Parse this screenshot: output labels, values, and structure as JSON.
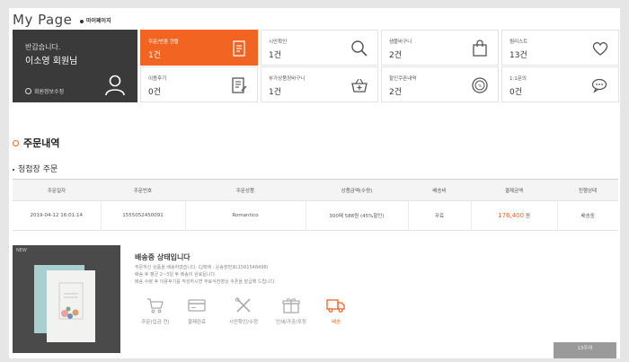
{
  "header": {
    "title": "My Page",
    "subtitle": "마이페이지"
  },
  "welcome": {
    "greeting": "반갑습니다.",
    "name": "이소영 회원님",
    "edit_label": "회원정보수정"
  },
  "tiles": [
    {
      "label": "주문/반품 현황",
      "count": "1건",
      "icon": "receipt-icon"
    },
    {
      "label": "시안확인",
      "count": "1건",
      "icon": "search-icon"
    },
    {
      "label": "샘플바구니",
      "count": "2건",
      "icon": "shopping-bag-icon"
    },
    {
      "label": "찜리스트",
      "count": "13건",
      "icon": "heart-icon"
    },
    {
      "label": "이용후기",
      "count": "0건",
      "icon": "review-icon"
    },
    {
      "label": "부가상품장바구니",
      "count": "1건",
      "icon": "basket-icon"
    },
    {
      "label": "할인쿠폰내역",
      "count": "2건",
      "icon": "coupon-icon"
    },
    {
      "label": "1:1문의",
      "count": "0건",
      "icon": "chat-icon"
    }
  ],
  "accent_color": "#f26422",
  "orders": {
    "section_title": "주문내역",
    "sub_title": "청첩장 주문",
    "columns": [
      "주문일자",
      "주문번호",
      "주문상품",
      "상품금액(수량)",
      "배송비",
      "결제금액",
      "진행상태"
    ],
    "rows": [
      {
        "date": "2019-04-12 16:01:14",
        "order_no": "1555052450091",
        "product": "Romantico",
        "amount": "300매 588원 (45%할인)",
        "shipping": "무료",
        "payment": "176,400",
        "currency": "원",
        "status": "배송중"
      }
    ]
  },
  "product_badge": "NEW",
  "shipping": {
    "title": "배송중 상태입니다",
    "lines": [
      "주문하신 상품을 배송하였습니다. CJ택배 : 운송장번호(1561548498)",
      "배송 후 평균 2~3일 후 배송이 완료됩니다.",
      "배송 수령 후 이용후기를 작성하시면 무료식전영상 쿠폰을 발급해 드립니다."
    ],
    "steps": [
      {
        "label": "주문(입금 전)",
        "icon": "cart-icon"
      },
      {
        "label": "결제완료",
        "icon": "card-icon"
      },
      {
        "label": "시안확인/수정",
        "icon": "tools-icon"
      },
      {
        "label": "인쇄/가공/포장",
        "icon": "gift-icon"
      },
      {
        "label": "배송",
        "icon": "truck-icon"
      }
    ]
  },
  "more_button": "13주여"
}
